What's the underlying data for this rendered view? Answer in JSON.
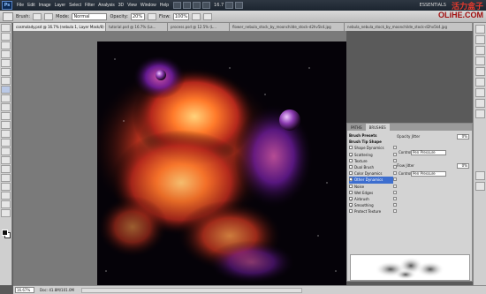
{
  "menubar": {
    "app_logo": "Ps",
    "items": [
      "File",
      "Edit",
      "Image",
      "Layer",
      "Select",
      "Filter",
      "Analysis",
      "3D",
      "View",
      "Window",
      "Help"
    ],
    "zoom": "16.7",
    "workspace": "ESSENTIALS",
    "brand_cn": "活力盒子"
  },
  "options": {
    "brush_label": "Brush:",
    "mode_label": "Mode:",
    "mode_value": "Normal",
    "opacity_label": "Opacity:",
    "opacity_value": "20%",
    "flow_label": "Flow:",
    "flow_value": "100%",
    "brand_site": "OLiHE.COM"
  },
  "tabs": [
    {
      "label": "cosmolady.psd @ 16.7% (nebula 1, Layer Mask/8) *",
      "active": true
    },
    {
      "label": "tutorial.psd @ 16.7% (La...",
      "active": false
    },
    {
      "label": "process.psd @ 12.5% (L...",
      "active": false
    },
    {
      "label": "flower_nebula_stock_by_moonchilde_stock-d2hv5k4.jpg",
      "active": false
    },
    {
      "label": "nebula_nebula_stock_by_moonchilde_stock-d2hv5k4.jpg",
      "active": false
    }
  ],
  "brush_panel": {
    "tabs": [
      {
        "label": "PATHS",
        "active": false
      },
      {
        "label": "BRUSHES",
        "active": true
      }
    ],
    "items": [
      {
        "label": "Brush Presets",
        "type": "head"
      },
      {
        "label": "Brush Tip Shape",
        "type": "head"
      },
      {
        "label": "Shape Dynamics",
        "checked": false
      },
      {
        "label": "Scattering",
        "checked": true
      },
      {
        "label": "Texture",
        "checked": false
      },
      {
        "label": "Dual Brush",
        "checked": false
      },
      {
        "label": "Color Dynamics",
        "checked": false
      },
      {
        "label": "Other Dynamics",
        "checked": true,
        "selected": true
      },
      {
        "label": "Noise",
        "checked": false
      },
      {
        "label": "Wet Edges",
        "checked": false
      },
      {
        "label": "Airbrush",
        "checked": true
      },
      {
        "label": "Smoothing",
        "checked": true
      },
      {
        "label": "Protect Texture",
        "checked": false
      }
    ],
    "opacity_jitter_label": "Opacity Jitter",
    "opacity_jitter_value": "0%",
    "control_label": "Control:",
    "control_value": "Pen Pressure",
    "flow_jitter_label": "Flow Jitter",
    "flow_jitter_value": "0%",
    "control2_value": "Pen Pressure"
  },
  "status": {
    "zoom": "16.67%",
    "doc": "Doc: 41.8M/101.0M"
  },
  "colors": {
    "menubar": "#1c2530",
    "panel": "#d3d3d3",
    "selected_row": "#3d6ecf",
    "brand_red": "#a20e0e"
  }
}
